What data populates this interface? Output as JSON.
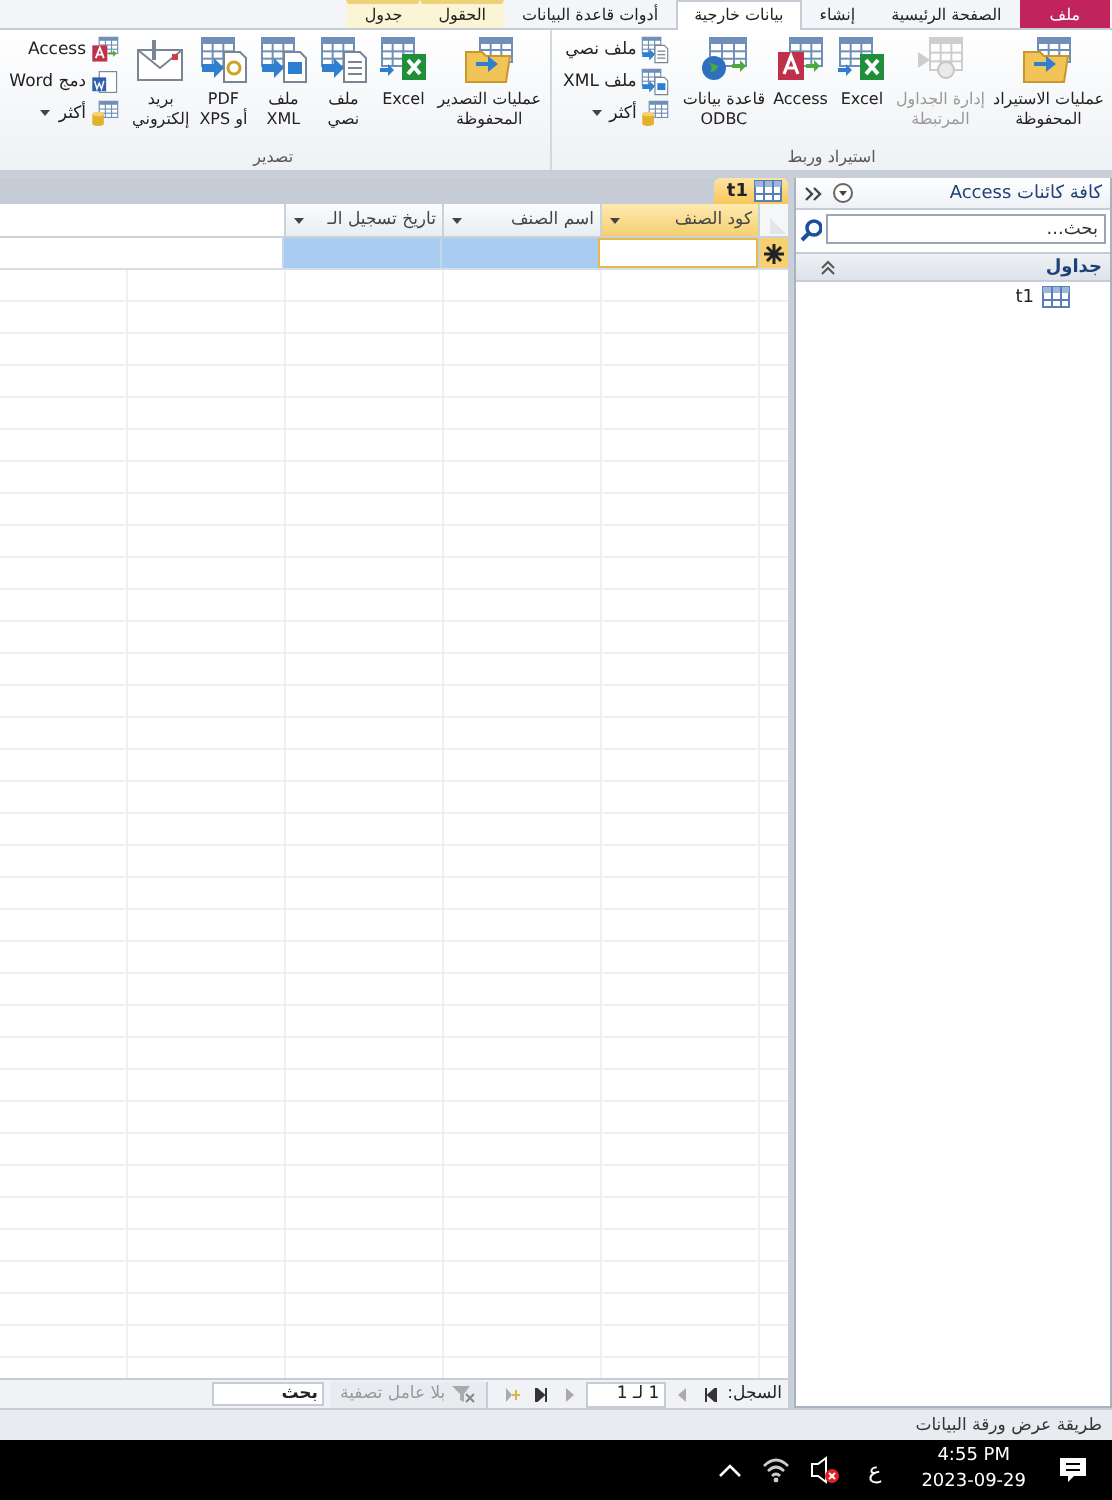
{
  "ribbon_tabs": [
    {
      "label": "ملف",
      "kind": "file",
      "selected": false,
      "contextual": false
    },
    {
      "label": "الصفحة الرئيسية",
      "kind": "normal",
      "selected": false,
      "contextual": false
    },
    {
      "label": "إنشاء",
      "kind": "normal",
      "selected": false,
      "contextual": false
    },
    {
      "label": "بيانات خارجية",
      "kind": "normal",
      "selected": true,
      "contextual": false
    },
    {
      "label": "أدوات قاعدة البيانات",
      "kind": "normal",
      "selected": false,
      "contextual": false
    },
    {
      "label": "الحقول",
      "kind": "normal",
      "selected": false,
      "contextual": true
    },
    {
      "label": "جدول",
      "kind": "normal",
      "selected": false,
      "contextual": true
    }
  ],
  "ribbon_groups": [
    {
      "label": "استيراد وربط",
      "buttons": [
        {
          "label": "عمليات الاستيراد\nالمحفوظة",
          "kind": "large",
          "disabled": false
        },
        {
          "label": "إدارة الجداول\nالمرتبطة",
          "kind": "large",
          "disabled": true
        },
        {
          "label": "Excel",
          "kind": "large",
          "disabled": false
        },
        {
          "label": "Access",
          "kind": "large",
          "disabled": false
        },
        {
          "label": "قاعدة بيانات\nODBC",
          "kind": "large",
          "disabled": false
        },
        {
          "label": "ملف نصي",
          "kind": "small",
          "disabled": false,
          "dropdown": false
        },
        {
          "label": "ملف XML",
          "kind": "small",
          "disabled": false,
          "dropdown": false
        },
        {
          "label": "أكثر",
          "kind": "small",
          "disabled": false,
          "dropdown": true
        }
      ]
    },
    {
      "label": "تصدير",
      "buttons": [
        {
          "label": "عمليات التصدير\nالمحفوظة",
          "kind": "large",
          "disabled": false
        },
        {
          "label": "Excel",
          "kind": "large",
          "disabled": false
        },
        {
          "label": "ملف\nنصي",
          "kind": "large",
          "disabled": false
        },
        {
          "label": "ملف\nXML",
          "kind": "large",
          "disabled": false
        },
        {
          "label": "PDF\nأو XPS",
          "kind": "large",
          "disabled": false
        },
        {
          "label": "بريد\nإلكتروني",
          "kind": "large",
          "disabled": false
        },
        {
          "label": "Access",
          "kind": "small",
          "disabled": false,
          "dropdown": false
        },
        {
          "label": "دمج Word",
          "kind": "small",
          "disabled": false,
          "dropdown": false
        },
        {
          "label": "أكثر",
          "kind": "small",
          "disabled": false,
          "dropdown": true
        }
      ]
    }
  ],
  "navigation_pane": {
    "title": "كافة كائنات Access",
    "search": {
      "placeholder": "بحث..."
    },
    "groups": [
      {
        "label": "جداول",
        "expanded": true,
        "items": [
          {
            "label": "t1"
          }
        ]
      }
    ]
  },
  "document": {
    "tab": "t1",
    "columns": [
      {
        "label": "كود الصنف",
        "selected": true
      },
      {
        "label": "اسم الصنف",
        "selected": false
      },
      {
        "label": "تاريخ تسجيل الـ",
        "selected": false
      }
    ]
  },
  "record_navigation": {
    "label": "السجل:",
    "position": "1 لـ 1",
    "filter": "بلا عامل تصفية",
    "search": {
      "placeholder": "بحث"
    }
  },
  "status_bar": {
    "text": "طريقة عرض ورقة البيانات"
  },
  "taskbar": {
    "time": "4:55 PM",
    "date": "2023-09-29",
    "input_language": "ع"
  }
}
